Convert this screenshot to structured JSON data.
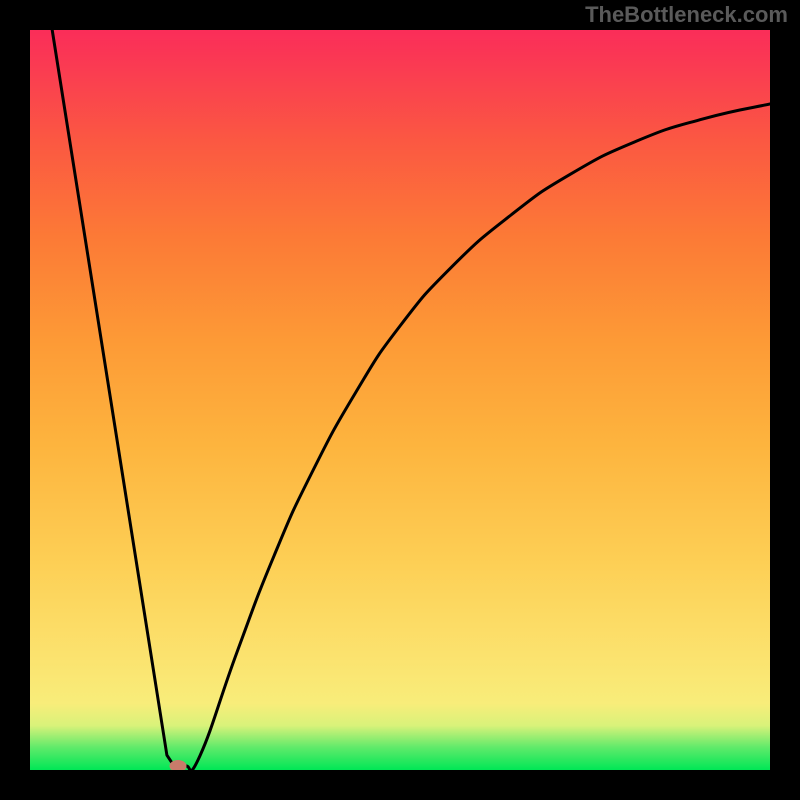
{
  "attribution": "TheBottleneck.com",
  "chart_data": {
    "type": "line",
    "title": "",
    "xlabel": "",
    "ylabel": "",
    "x_range": [
      0,
      100
    ],
    "y_range": [
      0,
      100
    ],
    "background_gradient_stops": [
      {
        "pos": 0,
        "color": "#00e756"
      },
      {
        "pos": 3,
        "color": "#5eea6a"
      },
      {
        "pos": 6,
        "color": "#d9f27a"
      },
      {
        "pos": 9,
        "color": "#f8ed7a"
      },
      {
        "pos": 15,
        "color": "#fbe36f"
      },
      {
        "pos": 28,
        "color": "#fdcf55"
      },
      {
        "pos": 44,
        "color": "#fdb43e"
      },
      {
        "pos": 58,
        "color": "#fd9a36"
      },
      {
        "pos": 72,
        "color": "#fc7a36"
      },
      {
        "pos": 85,
        "color": "#fb5842"
      },
      {
        "pos": 95,
        "color": "#fa3b52"
      },
      {
        "pos": 100,
        "color": "#fa2d59"
      }
    ],
    "series": [
      {
        "name": "curve",
        "color": "#000000",
        "points": [
          {
            "x": 3.0,
            "y": 100.0
          },
          {
            "x": 18.5,
            "y": 2.0
          },
          {
            "x": 19.5,
            "y": 0.5
          },
          {
            "x": 21.0,
            "y": 0.5
          },
          {
            "x": 23.0,
            "y": 2.0
          },
          {
            "x": 28.0,
            "y": 16.0
          },
          {
            "x": 33.0,
            "y": 29.0
          },
          {
            "x": 38.0,
            "y": 40.0
          },
          {
            "x": 44.0,
            "y": 51.0
          },
          {
            "x": 50.0,
            "y": 60.0
          },
          {
            "x": 57.0,
            "y": 68.0
          },
          {
            "x": 65.0,
            "y": 75.0
          },
          {
            "x": 73.0,
            "y": 80.5
          },
          {
            "x": 82.0,
            "y": 85.0
          },
          {
            "x": 91.0,
            "y": 88.0
          },
          {
            "x": 100.0,
            "y": 90.0
          }
        ]
      }
    ],
    "marker": {
      "x": 20.0,
      "y": 0.5,
      "shape": "ellipse",
      "color": "#c87b6a"
    }
  }
}
